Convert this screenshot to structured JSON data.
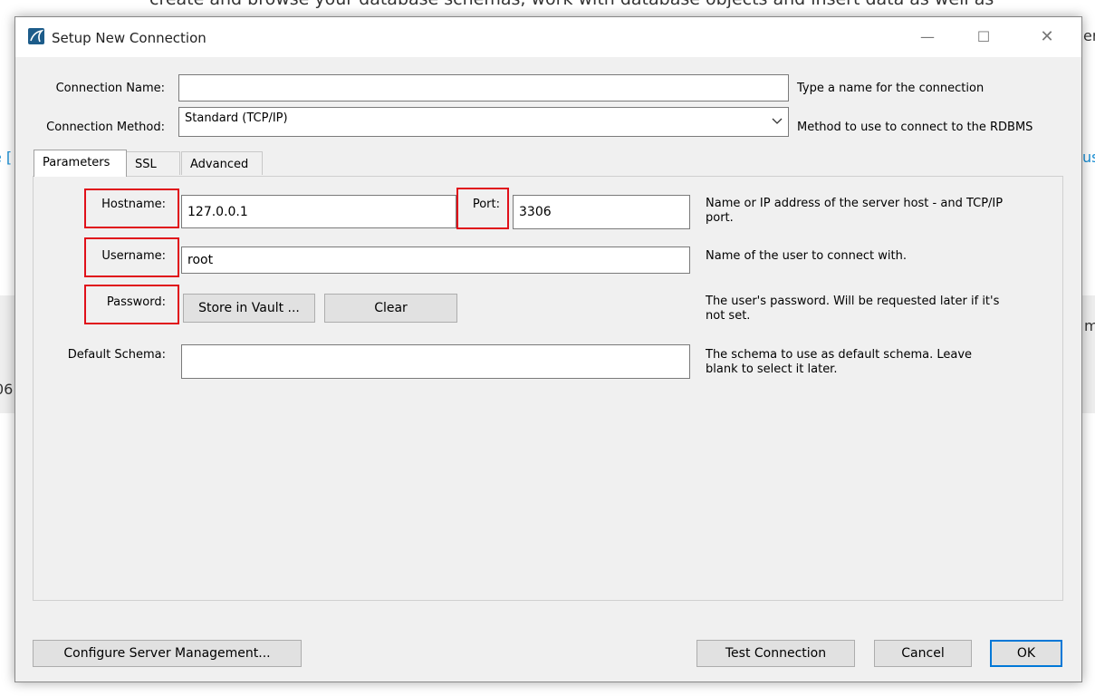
{
  "background": {
    "header_text": "create and browse your database schemas, work with database objects and insert data as well as",
    "right_frag_1": "er",
    "left_frag_1": "e [",
    "right_frag_2": "us",
    "right_frag_3": "m",
    "left_frag_2": "06"
  },
  "dialog": {
    "title": "Setup New Connection",
    "window_controls": {
      "minimize": "—",
      "maximize": "☐",
      "close": "✕"
    }
  },
  "form": {
    "connection_name_label": "Connection Name:",
    "connection_name_value": "",
    "connection_name_hint": "Type a name for the connection",
    "connection_method_label": "Connection Method:",
    "connection_method_value": "Standard (TCP/IP)",
    "connection_method_hint": "Method to use to connect to the RDBMS"
  },
  "tabs": [
    {
      "label": "Parameters",
      "active": true
    },
    {
      "label": "SSL",
      "active": false
    },
    {
      "label": "Advanced",
      "active": false
    }
  ],
  "parameters": {
    "hostname_label": "Hostname:",
    "hostname_value": "127.0.0.1",
    "port_label": "Port:",
    "port_value": "3306",
    "host_hint": "Name or IP address of the server host - and TCP/IP port.",
    "username_label": "Username:",
    "username_value": "root",
    "username_hint": "Name of the user to connect with.",
    "password_label": "Password:",
    "store_vault_label": "Store in Vault ...",
    "clear_label": "Clear",
    "password_hint": "The user's password. Will be requested later if it's not set.",
    "schema_label": "Default Schema:",
    "schema_value": "",
    "schema_hint": "The schema to use as default schema. Leave blank to select it later."
  },
  "footer": {
    "configure_label": "Configure Server Management...",
    "test_label": "Test Connection",
    "cancel_label": "Cancel",
    "ok_label": "OK"
  },
  "colors": {
    "highlight": "#e0101a",
    "accent": "#0078d7",
    "dialog_bg": "#f0f0f0"
  }
}
